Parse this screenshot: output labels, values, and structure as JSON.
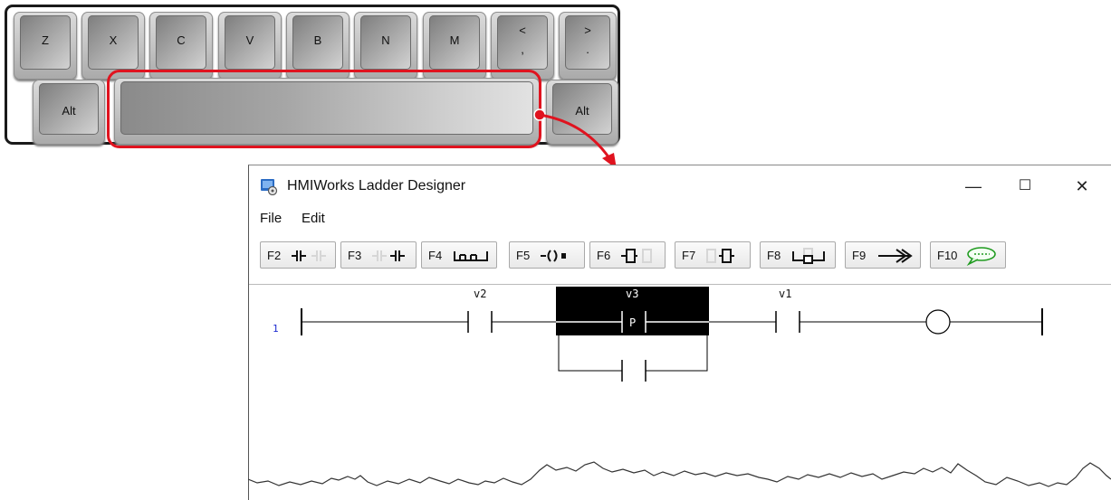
{
  "keyboard": {
    "row1": [
      "Z",
      "X",
      "C",
      "V",
      "B",
      "N",
      "M"
    ],
    "comma_key": {
      "top": "<",
      "bottom": ","
    },
    "period_key": {
      "top": ">",
      "bottom": "."
    },
    "alt_left": "Alt",
    "alt_right": "Alt"
  },
  "window": {
    "title": "HMIWorks Ladder Designer",
    "controls": {
      "minimize": "—",
      "maximize": "☐",
      "close": "✕"
    }
  },
  "menu": [
    "File",
    "Edit"
  ],
  "toolbar": [
    "F2",
    "F3",
    "F4",
    "F5",
    "F6",
    "F7",
    "F8",
    "F9",
    "F10"
  ],
  "ladder": {
    "rung_number": "1",
    "vars": [
      "v2",
      "v3",
      "v1"
    ],
    "selected_contact_label": "P"
  },
  "colors": {
    "highlight": "#e0131f",
    "rung_number": "#1d2bd0",
    "selection": "#000000"
  }
}
